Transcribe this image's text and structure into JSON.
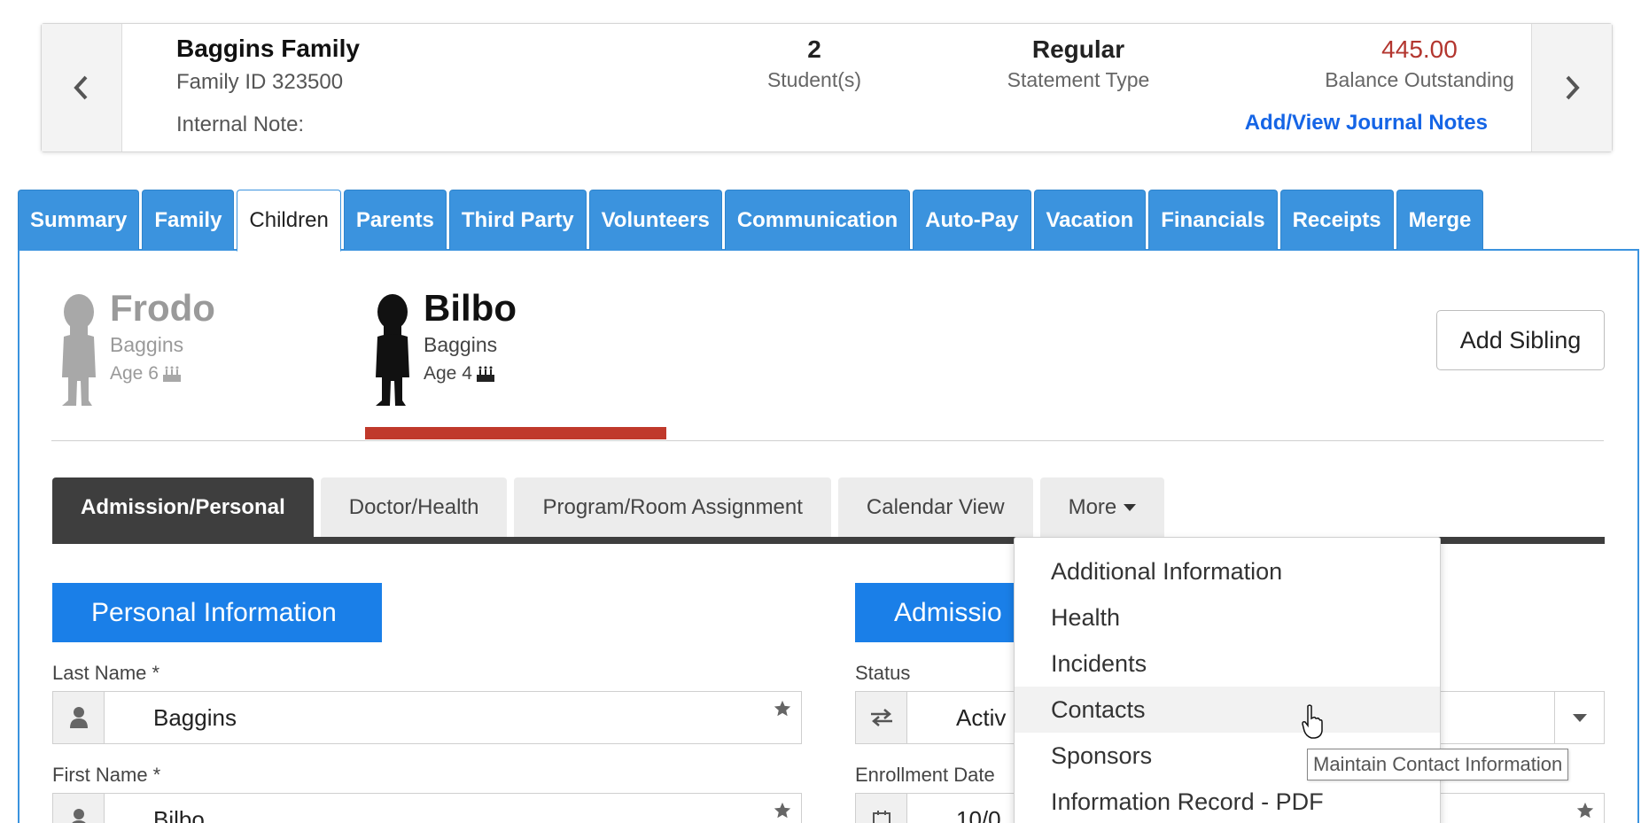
{
  "family": {
    "name": "Baggins Family",
    "id_label": "Family ID 323500",
    "internal_note_label": "Internal Note:",
    "students_value": "2",
    "students_label": "Student(s)",
    "statement_value": "Regular",
    "statement_label": "Statement Type",
    "balance_value": "445.00",
    "balance_label": "Balance Outstanding",
    "journal_link": "Add/View Journal Notes",
    "prev_icon": "chevron-left-icon",
    "next_icon": "chevron-right-icon"
  },
  "tabs": [
    {
      "label": "Summary"
    },
    {
      "label": "Family"
    },
    {
      "label": "Children",
      "active": true
    },
    {
      "label": "Parents"
    },
    {
      "label": "Third Party"
    },
    {
      "label": "Volunteers"
    },
    {
      "label": "Communication"
    },
    {
      "label": "Auto-Pay"
    },
    {
      "label": "Vacation"
    },
    {
      "label": "Financials"
    },
    {
      "label": "Receipts"
    },
    {
      "label": "Merge"
    }
  ],
  "children": [
    {
      "first": "Frodo",
      "last": "Baggins",
      "age": "Age 6",
      "selected": false
    },
    {
      "first": "Bilbo",
      "last": "Baggins",
      "age": "Age 4",
      "selected": true
    }
  ],
  "add_sibling_label": "Add Sibling",
  "subtabs": [
    {
      "label": "Admission/Personal",
      "active": true
    },
    {
      "label": "Doctor/Health"
    },
    {
      "label": "Program/Room Assignment"
    },
    {
      "label": "Calendar View"
    },
    {
      "label": "More"
    }
  ],
  "sections": {
    "personal": "Personal Information",
    "admission": "Admissio"
  },
  "fields": {
    "last_name": {
      "label": "Last Name *",
      "value": "Baggins"
    },
    "first_name": {
      "label": "First Name *",
      "value": "Bilbo"
    },
    "status": {
      "label": "Status",
      "value": "Activ"
    },
    "enrollment_date": {
      "label": "Enrollment Date",
      "value": "10/0"
    }
  },
  "more_menu": [
    "Additional Information",
    "Health",
    "Incidents",
    "Contacts",
    "Sponsors",
    "Information Record - PDF"
  ],
  "tooltip": "Maintain Contact Information",
  "colors": {
    "tab_blue": "#3b93de",
    "section_blue": "#1a7fe8",
    "balance_red": "#b3362f",
    "link_blue": "#1565e6",
    "selected_bar": "#c0392b"
  }
}
